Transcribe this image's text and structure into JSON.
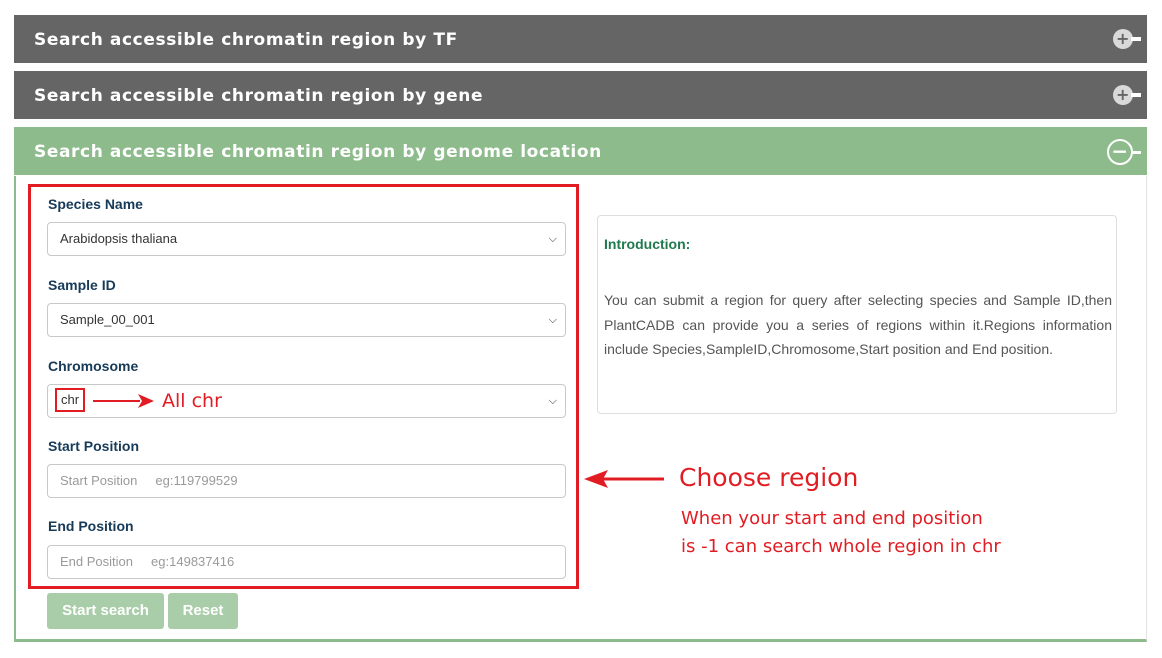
{
  "panels": {
    "tf": {
      "title": "Search accessible chromatin region by TF",
      "toggle": "+"
    },
    "gene": {
      "title": "Search accessible chromatin region by gene",
      "toggle": "+"
    },
    "location": {
      "title": "Search accessible chromatin region by genome location",
      "toggle": "−"
    }
  },
  "form": {
    "species_label": "Species Name",
    "species_value": "Arabidopsis thaliana",
    "sample_label": "Sample ID",
    "sample_value": "Sample_00_001",
    "chromosome_label": "Chromosome",
    "chromosome_value": "chr",
    "start_label": "Start Position",
    "start_placeholder": "Start Position     eg:119799529",
    "end_label": "End Position",
    "end_placeholder": "End Position     eg:149837416",
    "start_button": "Start search",
    "reset_button": "Reset"
  },
  "intro": {
    "title": "Introduction:",
    "text": "You can submit a region for query after selecting species and Sample ID,then PlantCADB can provide you a series of regions within it.Regions information include Species,SampleID,Chromosome,Start position and End position."
  },
  "annotations": {
    "all_chr": "All chr",
    "choose_region": "Choose region",
    "note_line1": "When your start and end position",
    "note_line2": "is -1 can search whole region in chr"
  },
  "colors": {
    "header_dark": "#646564",
    "header_green": "#8dbb8b",
    "annotation_red": "#e11d23",
    "button_green": "#a9cda9"
  }
}
